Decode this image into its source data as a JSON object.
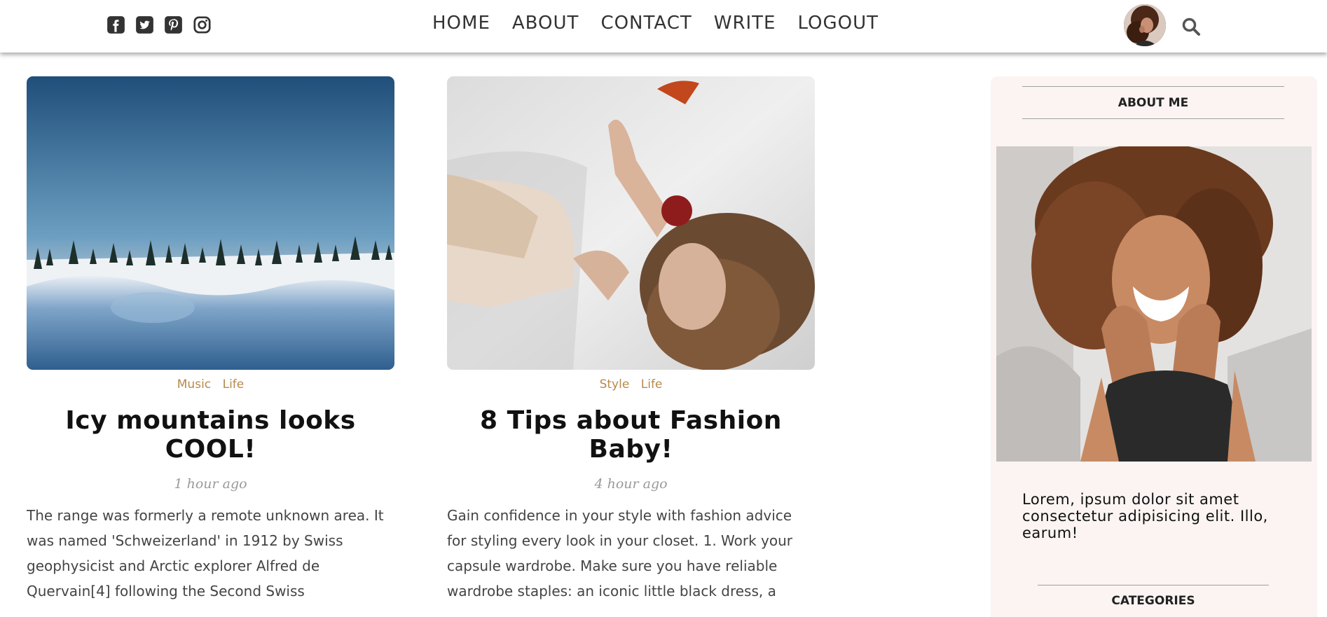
{
  "header": {
    "social_icons": [
      "facebook-square-icon",
      "twitter-square-icon",
      "pinterest-square-icon",
      "instagram-icon"
    ],
    "nav": [
      "HOME",
      "ABOUT",
      "CONTACT",
      "WRITE",
      "LOGOUT"
    ],
    "right_icons": [
      "avatar",
      "search-icon"
    ]
  },
  "posts": [
    {
      "categories": [
        "Music",
        "Life"
      ],
      "title": "Icy mountains looks COOL!",
      "time": "1 hour ago",
      "description": "The range was formerly a remote unknown area. It was named 'Schweizerland' in 1912 by Swiss geophysicist and Arctic explorer Alfred de Quervain[4] following the Second Swiss Expedition…"
    },
    {
      "categories": [
        "Style",
        "Life"
      ],
      "title": "8 Tips about Fashion Baby!",
      "time": "4 hour ago",
      "description": "Gain confidence in your style with fashion advice for styling every look in your closet. 1. Work your capsule wardrobe. Make sure you have reliable wardrobe staples: an iconic little black dress, a pair…"
    }
  ],
  "sidebar": {
    "about_title": "ABOUT ME",
    "about_text": "Lorem, ipsum dolor sit amet consectetur adipisicing elit. Illo, earum!",
    "categories_title": "CATEGORIES"
  },
  "colors": {
    "category_text": "#b8884b",
    "sidebar_bg": "#fbf4f2",
    "time_text": "#9a9a9a"
  }
}
